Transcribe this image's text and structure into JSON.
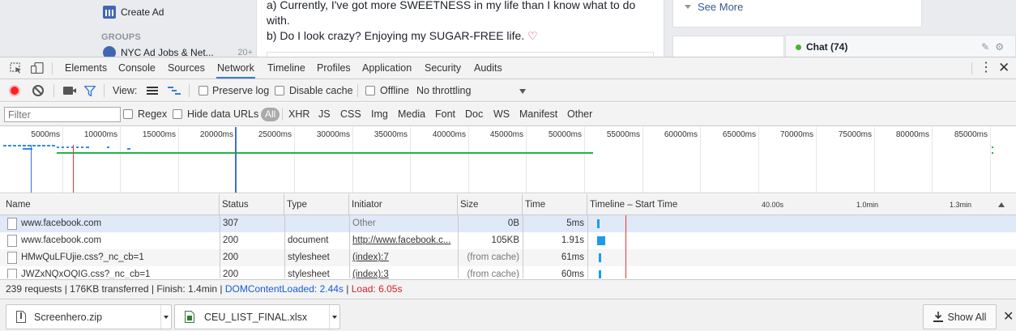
{
  "facebook": {
    "create_ad": "Create Ad",
    "groups_header": "GROUPS",
    "group_item": "NYC Ad Jobs & Net...",
    "group_count": "20+",
    "post_line1": "a) Currently, I've got more SWEETNESS in my life than I know what to do",
    "post_line2": "with.",
    "post_line3": "b) Do I look crazy? Enjoying my SUGAR-FREE life.",
    "heart": "♡",
    "see_more": "See More",
    "chat": "Chat (74)"
  },
  "devtools": {
    "tabs": [
      "Elements",
      "Console",
      "Sources",
      "Network",
      "Timeline",
      "Profiles",
      "Application",
      "Security",
      "Audits"
    ],
    "active_tab": "Network",
    "toolbar": {
      "view_label": "View:",
      "preserve_log": "Preserve log",
      "disable_cache": "Disable cache",
      "offline": "Offline",
      "throttling": "No throttling"
    },
    "filter": {
      "placeholder": "Filter",
      "regex": "Regex",
      "hide_data_urls": "Hide data URLs",
      "all": "All",
      "types": [
        "XHR",
        "JS",
        "CSS",
        "Img",
        "Media",
        "Font",
        "Doc",
        "WS",
        "Manifest",
        "Other"
      ]
    },
    "overview_ticks": [
      "5000ms",
      "10000ms",
      "15000ms",
      "20000ms",
      "25000ms",
      "30000ms",
      "35000ms",
      "40000ms",
      "45000ms",
      "50000ms",
      "55000ms",
      "60000ms",
      "65000ms",
      "70000ms",
      "75000ms",
      "80000ms",
      "85000ms"
    ],
    "columns": {
      "name": "Name",
      "status": "Status",
      "type": "Type",
      "initiator": "Initiator",
      "size": "Size",
      "time": "Time",
      "timeline": "Timeline – Start Time",
      "tl_marks": [
        "40.00s",
        "1.0min",
        "1.3min"
      ]
    },
    "rows": [
      {
        "name": "www.facebook.com",
        "status": "307",
        "type": "",
        "initiator": "Other",
        "size": "0B",
        "time": "5ms",
        "tl_start": 0.4,
        "tl_width": 0.3
      },
      {
        "name": "www.facebook.com",
        "status": "200",
        "type": "document",
        "initiator": "http://www.facebook.c...",
        "size": "105KB",
        "time": "1.91s",
        "tl_start": 0.4,
        "tl_width": 2.5
      },
      {
        "name": "HMwQuLFUjie.css?_nc_cb=1",
        "status": "200",
        "type": "stylesheet",
        "initiator": "(index):7",
        "size": "(from cache)",
        "time": "61ms",
        "tl_start": 0.5,
        "tl_width": 0.3
      },
      {
        "name": "JWZxNQxOQIG.css?_nc_cb=1",
        "status": "200",
        "type": "stylesheet",
        "initiator": "(index):3",
        "size": "(from cache)",
        "time": "60ms",
        "tl_start": 0.5,
        "tl_width": 0.3
      }
    ],
    "status": {
      "summary": "239 requests | 176KB transferred | Finish: 1.4min | ",
      "dom_loaded": "DOMContentLoaded: 2.44s",
      "sep": " | ",
      "load": "Load: 6.05s"
    }
  },
  "downloads": {
    "items": [
      "Screenhero.zip",
      "CEU_LIST_FINAL.xlsx"
    ],
    "show_all": "Show All"
  }
}
